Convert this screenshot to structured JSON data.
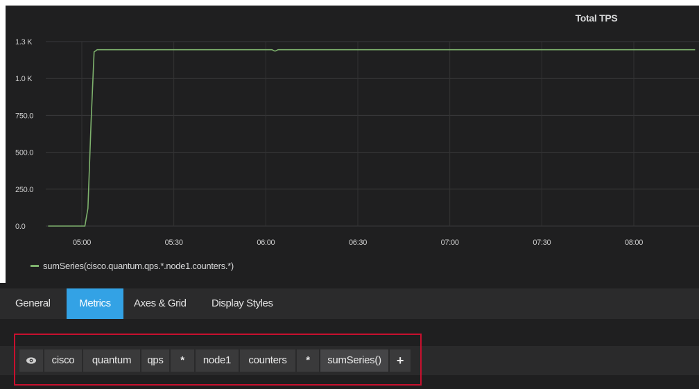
{
  "panel": {
    "title": "Total TPS",
    "background": "#1f1f20",
    "legend": [
      {
        "label": "sumSeries(cisco.quantum.qps.*.node1.counters.*)",
        "color": "#7eb26d"
      }
    ]
  },
  "chart_data": {
    "type": "line",
    "title": "Total TPS",
    "xlabel": "",
    "ylabel": "",
    "x_tick_labels": [
      "05:00",
      "05:30",
      "06:00",
      "06:30",
      "07:00",
      "07:30",
      "08:00"
    ],
    "y_tick_labels": [
      "0.0",
      "250.0",
      "500.0",
      "750.0",
      "1.0 K",
      "1.3 K"
    ],
    "ylim": [
      0,
      1250
    ],
    "grid": true,
    "legend_position": "bottom-left",
    "series": [
      {
        "name": "sumSeries(cisco.quantum.qps.*.node1.counters.*)",
        "color": "#7eb26d",
        "points": [
          [
            "04:49",
            0
          ],
          [
            "05:01",
            0
          ],
          [
            "05:02",
            120
          ],
          [
            "05:03",
            700
          ],
          [
            "05:04",
            1180
          ],
          [
            "05:05",
            1195
          ],
          [
            "05:10",
            1195
          ],
          [
            "05:30",
            1195
          ],
          [
            "06:02",
            1195
          ],
          [
            "06:03",
            1185
          ],
          [
            "06:04",
            1195
          ],
          [
            "06:30",
            1195
          ],
          [
            "07:00",
            1195
          ],
          [
            "07:30",
            1195
          ],
          [
            "08:00",
            1195
          ],
          [
            "08:20",
            1195
          ]
        ]
      }
    ]
  },
  "editor": {
    "tabs": [
      {
        "label": "General",
        "active": false
      },
      {
        "label": "Metrics",
        "active": true
      },
      {
        "label": "Axes & Grid",
        "active": false
      },
      {
        "label": "Display Styles",
        "active": false
      }
    ],
    "query_segments": [
      "cisco",
      "quantum",
      "qps",
      "*",
      "node1",
      "counters",
      "*"
    ],
    "function_label": "sumSeries()",
    "add_symbol": "+",
    "active_tab_color": "#33a2e5",
    "highlight_color": "#c8102e"
  }
}
